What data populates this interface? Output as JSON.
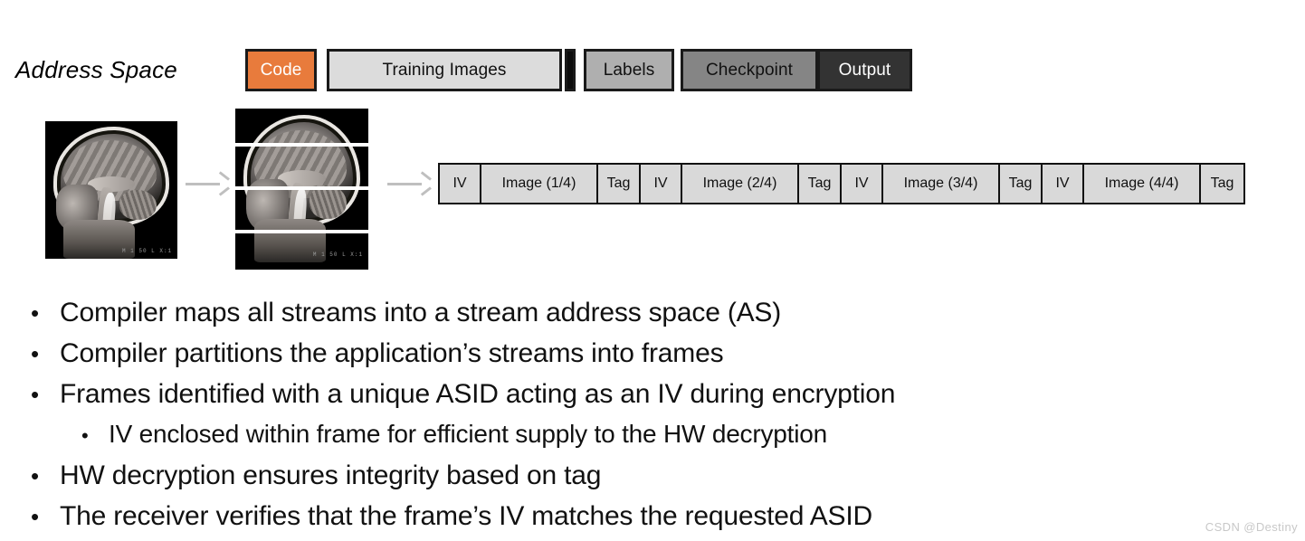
{
  "address_space": {
    "label": "Address Space",
    "blocks": [
      {
        "name": "code",
        "label": "Code",
        "color": "#E87B3C",
        "text_color": "#FFFFFF"
      },
      {
        "name": "training",
        "label": "Training Images",
        "color": "#DCDCDC",
        "text_color": "#111111"
      },
      {
        "name": "sliver",
        "label": "",
        "color": "#0D0D0D",
        "text_color": "#0D0D0D"
      },
      {
        "name": "labels",
        "label": "Labels",
        "color": "#AFAFAF",
        "text_color": "#111111"
      },
      {
        "name": "checkpoint",
        "label": "Checkpoint",
        "color": "#858585",
        "text_color": "#111111"
      },
      {
        "name": "output",
        "label": "Output",
        "color": "#333333",
        "text_color": "#FFFFFF"
      }
    ]
  },
  "pipeline": {
    "original_image_caption": "sagittal-mri-brain-scan",
    "sliced_image_caption": "sagittal-mri-brain-scan-4-slices",
    "scan_stamp": "M 1  50 L   X:1",
    "arrows": [
      "partition-arrow",
      "encrypt-arrow"
    ]
  },
  "frame_strip": {
    "cells": [
      {
        "type": "iv",
        "label": "IV"
      },
      {
        "type": "image",
        "label": "Image (1/4)"
      },
      {
        "type": "tag",
        "label": "Tag"
      },
      {
        "type": "iv",
        "label": "IV"
      },
      {
        "type": "image",
        "label": "Image (2/4)"
      },
      {
        "type": "tag",
        "label": "Tag"
      },
      {
        "type": "iv",
        "label": "IV"
      },
      {
        "type": "image",
        "label": "Image (3/4)"
      },
      {
        "type": "tag",
        "label": "Tag"
      },
      {
        "type": "iv",
        "label": "IV"
      },
      {
        "type": "image",
        "label": "Image (4/4)"
      },
      {
        "type": "tag",
        "label": "Tag"
      }
    ]
  },
  "bullets": [
    {
      "level": 1,
      "marker": "•",
      "text": "Compiler maps all streams into a stream address space (AS)"
    },
    {
      "level": 1,
      "marker": "•",
      "text": "Compiler partitions the application’s streams into frames"
    },
    {
      "level": 1,
      "marker": "•",
      "text": "Frames identified with a unique ASID acting as an IV during encryption"
    },
    {
      "level": 2,
      "marker": "•",
      "text": "IV enclosed within frame for efficient supply to the HW decryption"
    },
    {
      "level": 1,
      "marker": "•",
      "text": "HW decryption ensures integrity based on tag"
    },
    {
      "level": 1,
      "marker": "•",
      "text": "The receiver verifies that the frame’s IV matches the requested ASID"
    }
  ],
  "watermark": "CSDN @Destiny"
}
